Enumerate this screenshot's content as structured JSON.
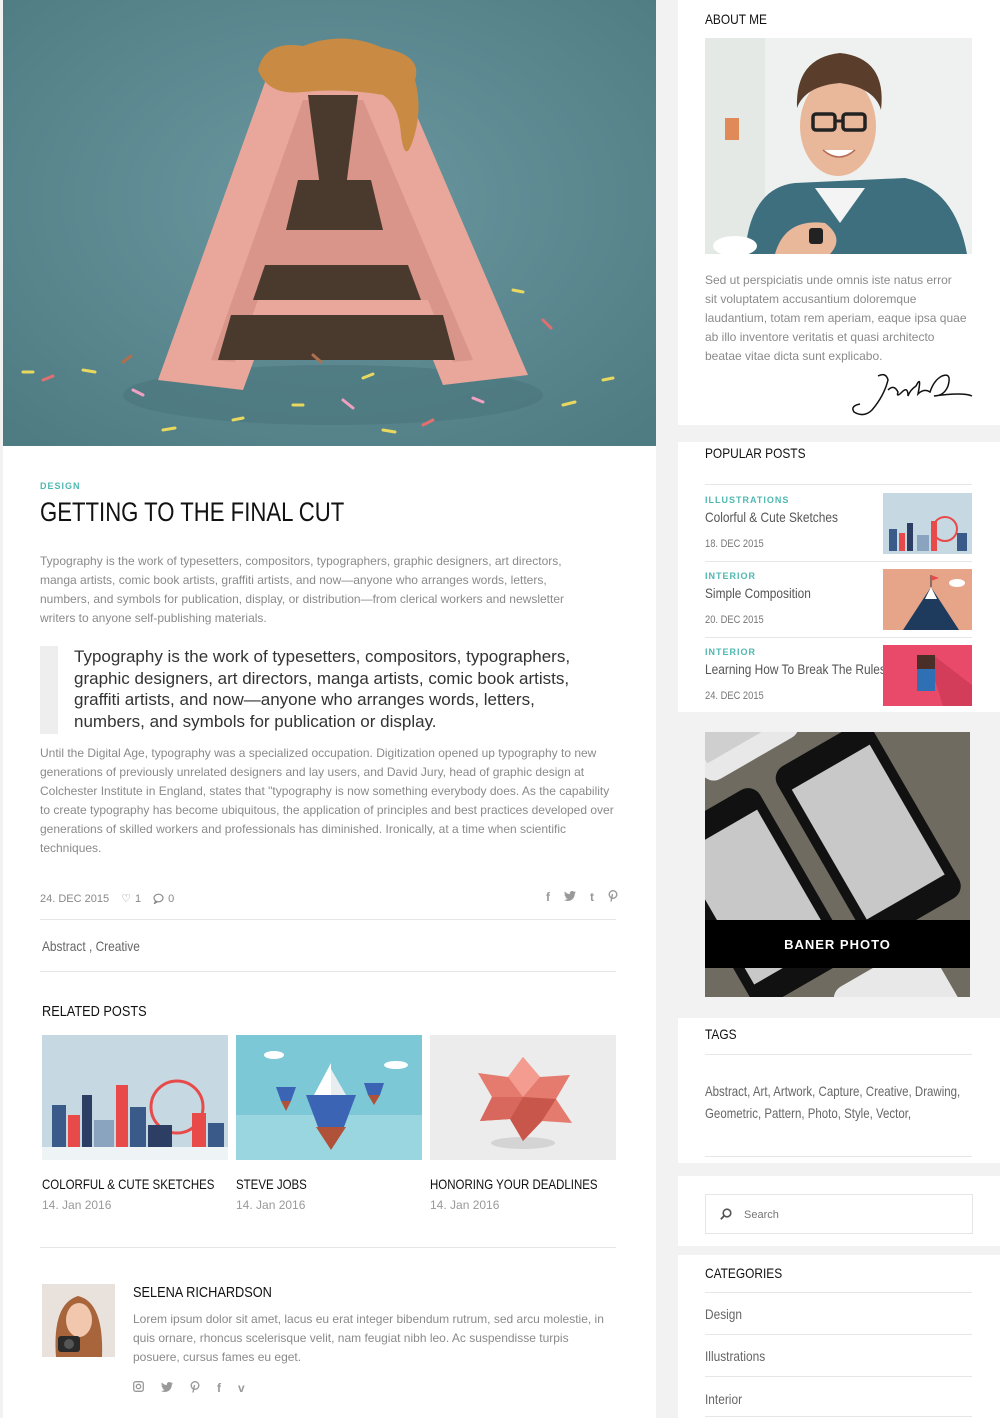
{
  "post": {
    "category": "DESIGN",
    "title": "GETTING TO THE FINAL CUT",
    "intro": "Typography is the work of typesetters, compositors, typographers, graphic designers, art directors, manga artists, comic book artists, graffiti artists, and now—anyone who arranges words, letters, numbers, and symbols for publication, display, or distribution—from clerical workers and newsletter writers to anyone self-publishing materials.",
    "quote": "Typography is the work of typesetters, compositors, typographers, graphic designers, art directors, manga artists, comic book artists, graffiti artists, and now—anyone who arranges words, letters, numbers, and symbols for publication or display.",
    "body": "Until the Digital Age, typography was a specialized occupation. Digitization opened up typography to new generations of previously unrelated designers and lay users, and David Jury, head of graphic design at Colchester Institute in England, states that \"typography is now something everybody does. As the capability to create typography has become ubiquitous, the application of principles and best practices developed over generations of skilled workers and professionals has diminished. Ironically, at a time when scientific techniques.",
    "date": "24. DEC 2015",
    "likes": "1",
    "comments": "0",
    "tags": "Abstract , Creative"
  },
  "related": {
    "title": "RELATED POSTS",
    "items": [
      {
        "title": "COLORFUL & CUTE SKETCHES",
        "date": "14. Jan 2016"
      },
      {
        "title": "STEVE JOBS",
        "date": "14. Jan 2016"
      },
      {
        "title": "HONORING YOUR DEADLINES",
        "date": "14. Jan 2016"
      }
    ]
  },
  "author": {
    "name": "SELENA RICHARDSON",
    "bio": "Lorem ipsum dolor sit amet, lacus eu erat integer bibendum rutrum, sed arcu molestie, in quis ornare, rhoncus scelerisque velit, nam feugiat nibh leo. Ac suspendisse turpis posuere, cursus fames eu eget."
  },
  "sidebar": {
    "about": {
      "title": "ABOUT ME",
      "text": "Sed ut perspiciatis unde omnis iste natus error sit voluptatem accusantium doloremque laudantium, totam rem aperiam, eaque ipsa quae ab illo inventore veritatis et quasi architecto beatae vitae dicta sunt explicabo."
    },
    "popular": {
      "title": "POPULAR POSTS",
      "items": [
        {
          "category": "ILLUSTRATIONS",
          "title": "Colorful & Cute Sketches",
          "date": "18. DEC 2015"
        },
        {
          "category": "INTERIOR",
          "title": "Simple Composition",
          "date": "20. DEC 2015"
        },
        {
          "category": "INTERIOR",
          "title": "Learning How To Break The Rules",
          "date": "24. DEC 2015"
        }
      ]
    },
    "banner": {
      "label": "BANER PHOTO"
    },
    "tags": {
      "title": "TAGS",
      "text": "Abstract, Art, Artwork, Capture, Creative, Drawing, Geometric, Pattern, Photo, Style, Vector,"
    },
    "search": {
      "placeholder": "Search"
    },
    "categories": {
      "title": "CATEGORIES",
      "items": [
        "Design",
        "Illustrations",
        "Interior"
      ]
    }
  },
  "colors": {
    "accent": "#4fb8b0",
    "hero_bg": "#5e8a91"
  }
}
